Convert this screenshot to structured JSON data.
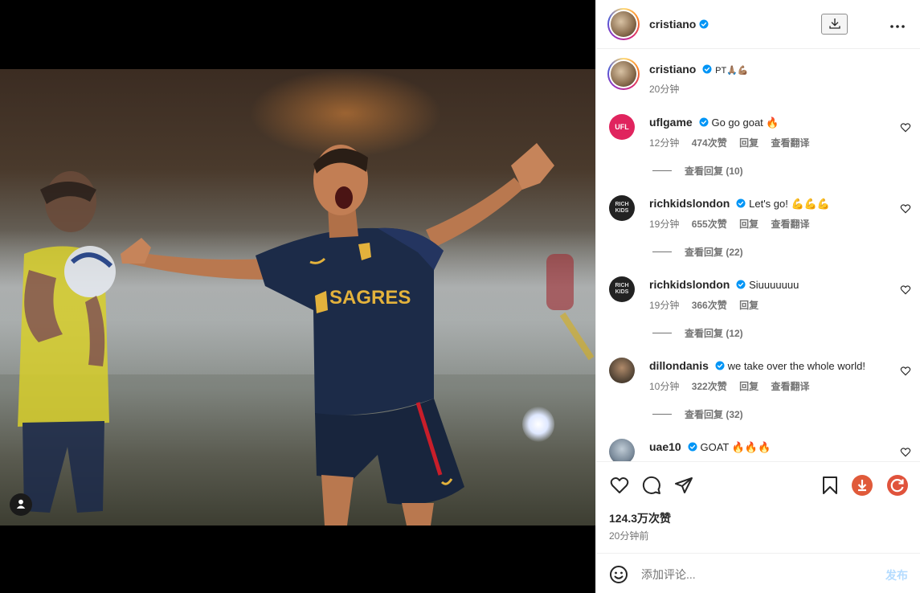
{
  "header": {
    "username": "cristiano"
  },
  "caption": {
    "username": "cristiano",
    "text": "PT🙏🏽💪🏽",
    "time": "20分钟"
  },
  "comments": [
    {
      "username": "uflgame",
      "text": "Go go goat 🔥",
      "time": "12分钟",
      "likes": "474次赞",
      "reply": "回复",
      "translate": "查看翻译",
      "view_replies": "查看回复 (10)",
      "avatar_color": "#e0245e",
      "avatar_text": "UFL"
    },
    {
      "username": "richkidslondon",
      "text": "Let's go! 💪💪💪",
      "time": "19分钟",
      "likes": "655次赞",
      "reply": "回复",
      "translate": "查看翻译",
      "view_replies": "查看回复 (22)",
      "avatar_color": "#222222",
      "avatar_text": "RICH KIDS"
    },
    {
      "username": "richkidslondon",
      "text": "Siuuuuuuu",
      "time": "19分钟",
      "likes": "366次赞",
      "reply": "回复",
      "translate": "",
      "view_replies": "查看回复 (12)",
      "avatar_color": "#222222",
      "avatar_text": "RICH KIDS"
    },
    {
      "username": "dillondanis",
      "text": "we take over the whole world!",
      "time": "10分钟",
      "likes": "322次赞",
      "reply": "回复",
      "translate": "查看翻译",
      "view_replies": "查看回复 (32)",
      "avatar_color": "#5a4a3a",
      "avatar_text": ""
    },
    {
      "username": "uae10",
      "text": "GOAT 🔥🔥🔥",
      "avatar_color": "#7a8a9a",
      "avatar_text": ""
    }
  ],
  "footer": {
    "likes": "124.3万次赞",
    "time": "20分钟前",
    "comment_placeholder": "添加评论...",
    "post_label": "发布"
  },
  "colors": {
    "verified": "#0095f6",
    "post_disabled": "#b3dbff",
    "ufl_red": "#e0245e"
  },
  "icons": [
    "heart-icon",
    "comment-icon",
    "share-icon",
    "bookmark-icon",
    "download-icon",
    "refresh-icon",
    "smile-icon",
    "more-icon",
    "user-tag-icon"
  ]
}
